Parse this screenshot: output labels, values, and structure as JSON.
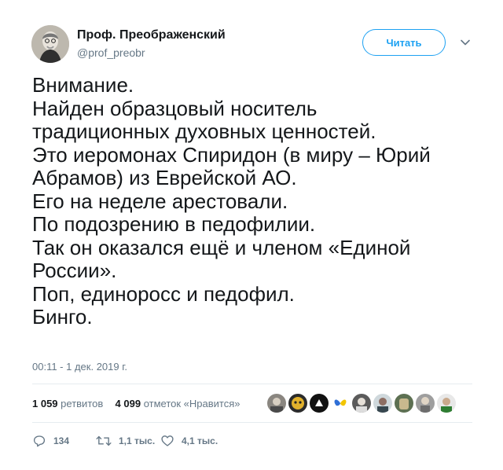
{
  "author": {
    "name": "Проф. Преображенский",
    "handle": "@prof_preobr"
  },
  "follow_label": "Читать",
  "tweet_lines": [
    "Внимание.",
    "Найден образцовый носитель",
    "традиционных духовных ценностей.",
    "Это иеромонах Спиридон (в миру – Юрий",
    "Абрамов) из Еврейской АО.",
    "Его на неделе арестовали.",
    "По подозрению в педофилии.",
    "Так он оказался ещё и членом «Единой",
    "России».",
    "Поп, единоросс и педофил.",
    "Бинго."
  ],
  "timestamp": "00:11 - 1 дек. 2019 г.",
  "stats": {
    "retweets_count": "1 059",
    "retweets_label": "ретвитов",
    "likes_count": "4 099",
    "likes_label": "отметок «Нравится»"
  },
  "actions": {
    "replies": "134",
    "retweets": "1,1 тыс.",
    "likes": "4,1 тыс."
  },
  "icons": {
    "reply": "reply-icon",
    "retweet": "retweet-icon",
    "like": "heart-icon",
    "caret": "chevron-down-icon"
  },
  "colors": {
    "accent": "#1da1f2",
    "text": "#14171a",
    "muted": "#657786",
    "divider": "#e6ecf0"
  }
}
